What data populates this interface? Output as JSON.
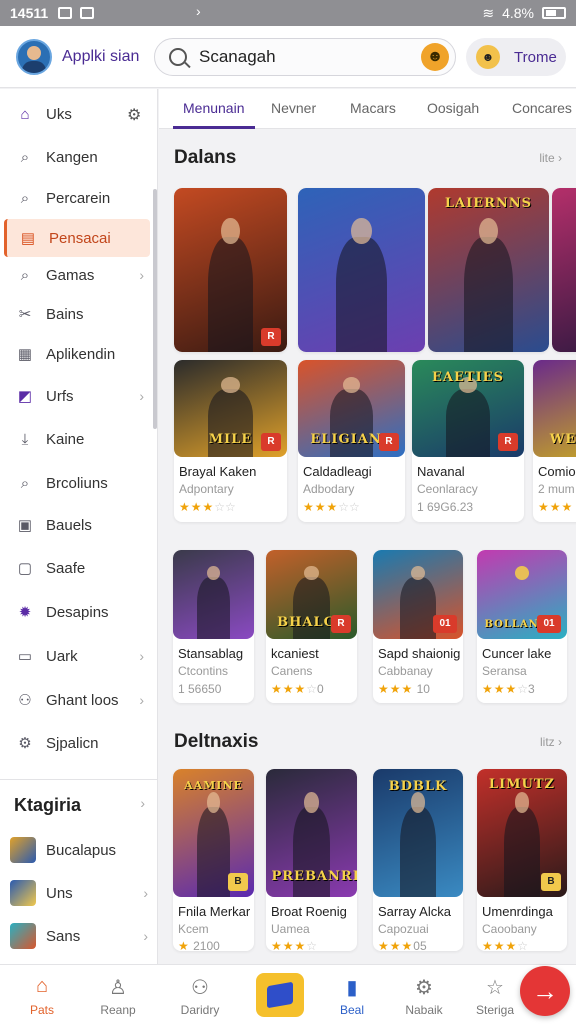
{
  "status_bar": {
    "time": "14511",
    "battery": "4.8%"
  },
  "header": {
    "app_name": "Applki sian",
    "search_value": "Scanagah",
    "user_name": "Trome"
  },
  "sidebar": {
    "items": [
      {
        "label": "Uks",
        "icon": "home-icon"
      },
      {
        "label": "Kangen",
        "icon": "search-icon"
      },
      {
        "label": "Percarein",
        "icon": "search-icon"
      },
      {
        "label": "Pensacai",
        "icon": "calendar-icon"
      },
      {
        "label": "Gamas",
        "icon": "search-icon"
      },
      {
        "label": "Bains",
        "icon": "tools-icon"
      },
      {
        "label": "Aplikendin",
        "icon": "grid-icon"
      },
      {
        "label": "Urfs",
        "icon": "image-icon"
      },
      {
        "label": "Kaine",
        "icon": "download-icon"
      },
      {
        "label": "Brcoliuns",
        "icon": "search-icon"
      },
      {
        "label": "Bauels",
        "icon": "box-icon"
      },
      {
        "label": "Saafe",
        "icon": "safe-icon"
      },
      {
        "label": "Desapins",
        "icon": "settings-icon"
      },
      {
        "label": "Uark",
        "icon": "square-icon"
      },
      {
        "label": "Ghant loos",
        "icon": "people-icon"
      },
      {
        "label": "Sjpalicn",
        "icon": "gear-icon"
      }
    ],
    "category_title": "Ktagiria",
    "categories": [
      {
        "label": "Bucalapus",
        "color": "#e0a12a"
      },
      {
        "label": "Uns",
        "color": "#f2c94c"
      },
      {
        "label": "Sans",
        "color": "#d8562c"
      }
    ]
  },
  "tabs": [
    "Menunain",
    "Nevner",
    "Macars",
    "Oosigah",
    "Concares"
  ],
  "section1": {
    "title": "Dalans",
    "more": "lite",
    "featured": [
      {
        "art": [
          "#c34a22",
          "#3a1a12"
        ]
      },
      {
        "art": [
          "#2e63b8",
          "#6c3fb0"
        ]
      },
      {
        "art": [
          "#b03a2e",
          "#2a4c8f"
        ],
        "logo": "LAIERNNS"
      },
      {
        "art": [
          "#b42f6a",
          "#3b1a44"
        ]
      }
    ],
    "row2": [
      {
        "title": "Brayal Kaken",
        "sub": "Adpontary",
        "stars": "★★★",
        "stars_off": "☆☆",
        "logo": "MILE",
        "badge": "R",
        "art": [
          "#2b2b2b",
          "#e0a12a"
        ]
      },
      {
        "title": "Caldadleagi",
        "sub": "Adbodary",
        "stars": "★★★",
        "stars_off": "☆☆",
        "logo": "ELIGIANE",
        "badge": "R",
        "art": [
          "#d9532a",
          "#2d6fc4"
        ]
      },
      {
        "title": "Navanal",
        "sub": "Ceonlaracy",
        "rating": "1 69G6.23",
        "logo": "EAETIES",
        "badge": "R",
        "art": [
          "#2a8a5a",
          "#1a3a6a"
        ]
      },
      {
        "title": "Comiol",
        "sub": "2 mum",
        "stars": "★★★",
        "logo": "WE",
        "art": [
          "#6a2a8a",
          "#c2a02a"
        ]
      }
    ]
  },
  "section2": {
    "row": [
      {
        "title": "Stansablag",
        "sub": "Ctcontins",
        "rating": "1 56650",
        "art": [
          "#3a3a4a",
          "#8a4ac2"
        ]
      },
      {
        "title": "kcaniest",
        "sub": "Canens",
        "stars": "★★★",
        "stars_off": "☆",
        "rating": "0",
        "logo": "BHALCE",
        "badge": "R",
        "art": [
          "#c2602a",
          "#2a5a2a"
        ]
      },
      {
        "title": "Sapd shaionig",
        "sub": "Cabbanay",
        "stars": "★★★",
        "rating": "10",
        "badge": "01",
        "art": [
          "#1a7ab0",
          "#d9532a"
        ]
      },
      {
        "title": "Cuncer lake",
        "sub": "Seransa",
        "stars": "★★★",
        "stars_off": "☆",
        "rating": "3",
        "logo": "BOLLANIIR",
        "badge": "01",
        "art": [
          "#c23ab0",
          "#2ab0c2"
        ]
      }
    ]
  },
  "section3": {
    "title": "Deltnaxis",
    "more": "litz",
    "row": [
      {
        "title": "Fnila Merkar",
        "sub": "Kcem",
        "stars": "★",
        "rating": "2100",
        "logo": "AAMINE",
        "badge": "B",
        "art": [
          "#d9822a",
          "#5a2ab0"
        ]
      },
      {
        "title": "Broat Roenig",
        "sub": "Uamea",
        "stars": "★★★",
        "stars_off": "☆",
        "logo": "PREBANRE",
        "art": [
          "#2a2a3a",
          "#8a3ab0"
        ]
      },
      {
        "title": "Sarray Alcka",
        "sub": "Capozuai",
        "stars": "★★★",
        "rating": "05",
        "logo": "BDBLK",
        "art": [
          "#1a3a6a",
          "#3a8ac2"
        ]
      },
      {
        "title": "Umenrdinga",
        "sub": "Caoobany",
        "stars": "★★★",
        "stars_off": "☆",
        "logo": "LIMUTZ",
        "badge": "B",
        "art": [
          "#c2302a",
          "#2a1a1a"
        ]
      }
    ]
  },
  "bottom_nav": [
    {
      "label": "Pats",
      "icon": "home-icon"
    },
    {
      "label": "Reanp",
      "icon": "user-icon"
    },
    {
      "label": "Daridry",
      "icon": "people-icon"
    },
    {
      "label": "",
      "icon": "store-icon"
    },
    {
      "label": "Beal",
      "icon": "book-icon"
    },
    {
      "label": "Nabaik",
      "icon": "gear-icon"
    },
    {
      "label": "Steriga",
      "icon": "star-icon"
    }
  ],
  "fab_icon": "arrow-right-icon"
}
